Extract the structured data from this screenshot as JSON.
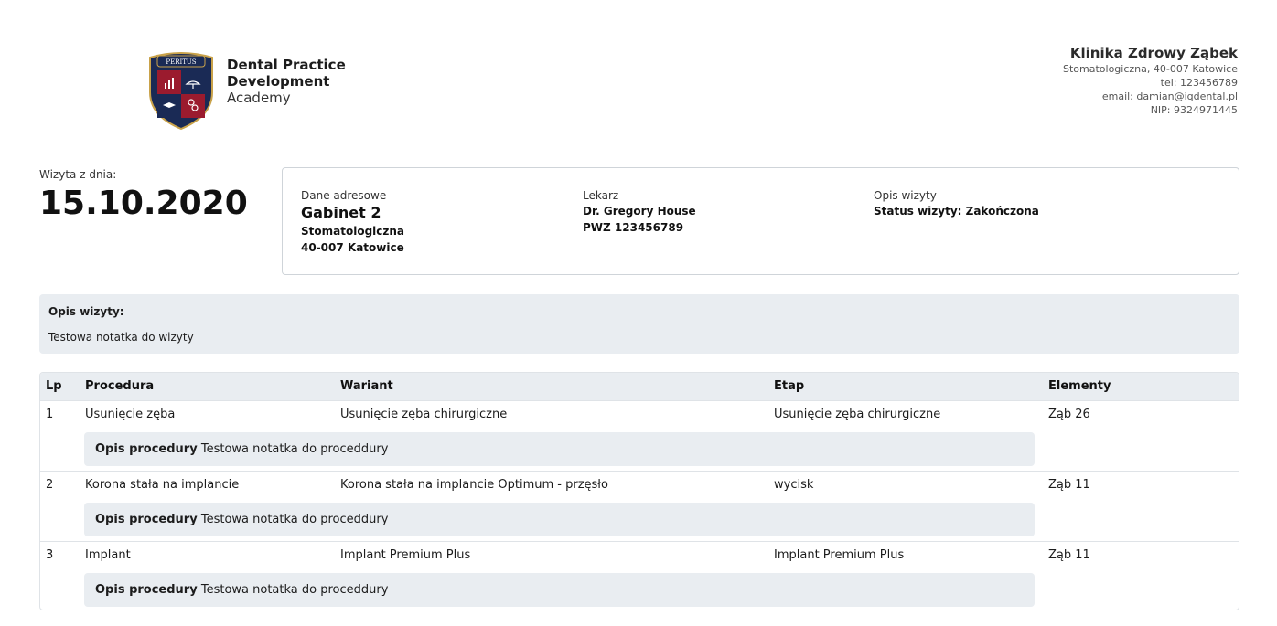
{
  "logo": {
    "shield_text": "PERITUS",
    "line1": "Dental Practice",
    "line2": "Development",
    "line3": "Academy",
    "colors": {
      "navy": "#1a2a55",
      "red": "#9b1b2e",
      "gold": "#c9a24a"
    }
  },
  "clinic": {
    "name": "Klinika Zdrowy Ząbek",
    "address": "Stomatologiczna, 40-007 Katowice",
    "tel": "tel: 123456789",
    "email": "email: damian@iqdental.pl",
    "nip": "NIP: 9324971445"
  },
  "visit": {
    "date_label": "Wizyta z dnia:",
    "date": "15.10.2020"
  },
  "info": {
    "address_label": "Dane adresowe",
    "office": "Gabinet 2",
    "street": "Stomatologiczna",
    "city": "40-007 Katowice",
    "doctor_label": "Lekarz",
    "doctor": "Dr. Gregory House",
    "pwz": "PWZ 123456789",
    "desc_label": "Opis wizyty",
    "status": "Status wizyty: Zakończona"
  },
  "note": {
    "title": "Opis wizyty:",
    "text": "Testowa notatka do wizyty"
  },
  "table": {
    "headers": [
      "Lp",
      "Procedura",
      "Wariant",
      "Etap",
      "Elementy"
    ],
    "desc_label": "Opis procedury",
    "rows": [
      {
        "lp": "1",
        "procedure": "Usunięcie zęba",
        "variant": "Usunięcie zęba chirurgiczne",
        "stage": "Usunięcie zęba chirurgiczne",
        "elements": "Ząb 26",
        "desc": "Testowa notatka do proceddury"
      },
      {
        "lp": "2",
        "procedure": "Korona stała na implancie",
        "variant": "Korona stała na implancie Optimum - przęsło",
        "stage": "wycisk",
        "elements": "Ząb 11",
        "desc": "Testowa notatka do proceddury"
      },
      {
        "lp": "3",
        "procedure": "Implant",
        "variant": "Implant Premium Plus",
        "stage": "Implant Premium Plus",
        "elements": "Ząb 11",
        "desc": "Testowa notatka do proceddury"
      }
    ]
  }
}
